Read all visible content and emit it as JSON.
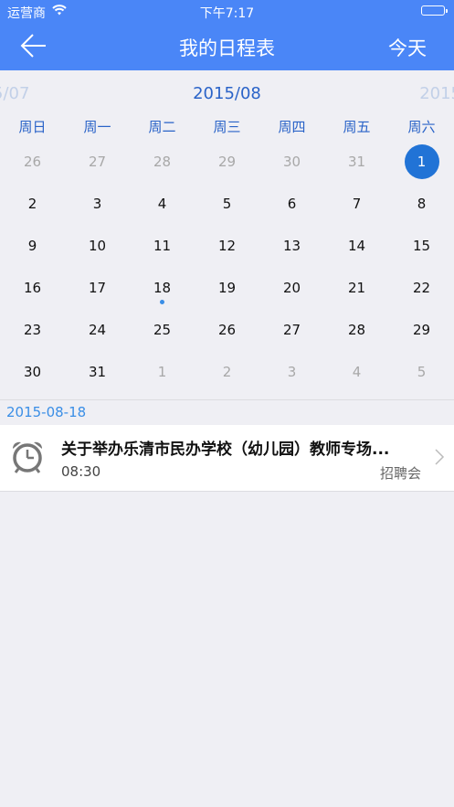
{
  "status_bar": {
    "carrier": "运营商",
    "time": "下午7:17"
  },
  "nav": {
    "title": "我的日程表",
    "today": "今天"
  },
  "calendar": {
    "prev_month": "5/07",
    "current_month": "2015/08",
    "next_month": "2015",
    "weekdays": [
      "周日",
      "周一",
      "周二",
      "周三",
      "周四",
      "周五",
      "周六"
    ],
    "weeks": [
      [
        "26",
        "27",
        "28",
        "29",
        "30",
        "31",
        "1"
      ],
      [
        "2",
        "3",
        "4",
        "5",
        "6",
        "7",
        "8"
      ],
      [
        "9",
        "10",
        "11",
        "12",
        "13",
        "14",
        "15"
      ],
      [
        "16",
        "17",
        "18",
        "19",
        "20",
        "21",
        "22"
      ],
      [
        "23",
        "24",
        "25",
        "26",
        "27",
        "28",
        "29"
      ],
      [
        "30",
        "31",
        "1",
        "2",
        "3",
        "4",
        "5"
      ]
    ],
    "selected_date": "1",
    "event_dot_date": "18"
  },
  "schedule": {
    "date": "2015-08-18",
    "events": [
      {
        "title": "关于举办乐清市民办学校（幼儿园）教师专场...",
        "time": "08:30",
        "category": "招聘会",
        "icon": "alarm-clock-icon"
      }
    ]
  },
  "colors": {
    "accent": "#4a86f7",
    "selected": "#2173d6",
    "link": "#3a8ee6",
    "month": "#2a63c8"
  }
}
